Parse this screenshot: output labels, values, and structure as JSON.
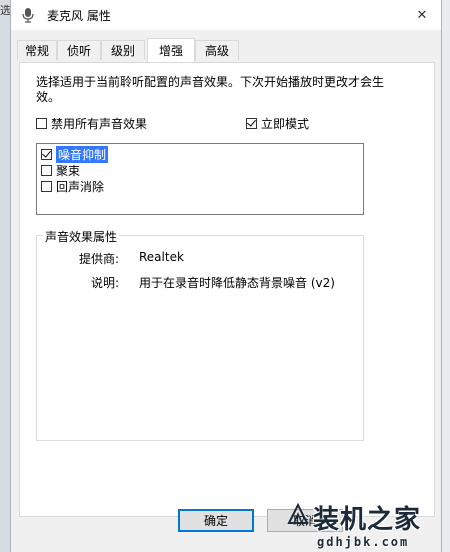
{
  "window": {
    "title": "麦克风 属性",
    "close_glyph": "✕",
    "icon": "microphone-icon"
  },
  "background": {
    "left_glyph": "选"
  },
  "tabs": [
    {
      "label": "常规",
      "active": false
    },
    {
      "label": "侦听",
      "active": false
    },
    {
      "label": "级别",
      "active": false
    },
    {
      "label": "增强",
      "active": true
    },
    {
      "label": "高级",
      "active": false
    }
  ],
  "enhancements": {
    "description": "选择适用于当前聆听配置的声音效果。下次开始播放时更改才会生效。",
    "disable_all": {
      "label": "禁用所有声音效果",
      "checked": false
    },
    "immediate_mode": {
      "label": "立即模式",
      "checked": true
    },
    "effects": [
      {
        "label": "噪音抑制",
        "checked": true,
        "selected": true
      },
      {
        "label": "聚束",
        "checked": false,
        "selected": false
      },
      {
        "label": "回声消除",
        "checked": false,
        "selected": false
      }
    ],
    "properties": {
      "legend": "声音效果属性",
      "provider_label": "提供商:",
      "provider_value": "Realtek",
      "description_label": "说明:",
      "description_value": "用于在录音时降低静态背景噪音 (v2)"
    }
  },
  "buttons": {
    "ok": "确定",
    "cancel": "取消"
  },
  "watermark": {
    "main": "装机之家",
    "sub": "gdhjbk.com"
  },
  "colors": {
    "selection": "#3377ff",
    "default_button_border": "#0078d7",
    "dialog_bg": "#f0f0f0"
  }
}
